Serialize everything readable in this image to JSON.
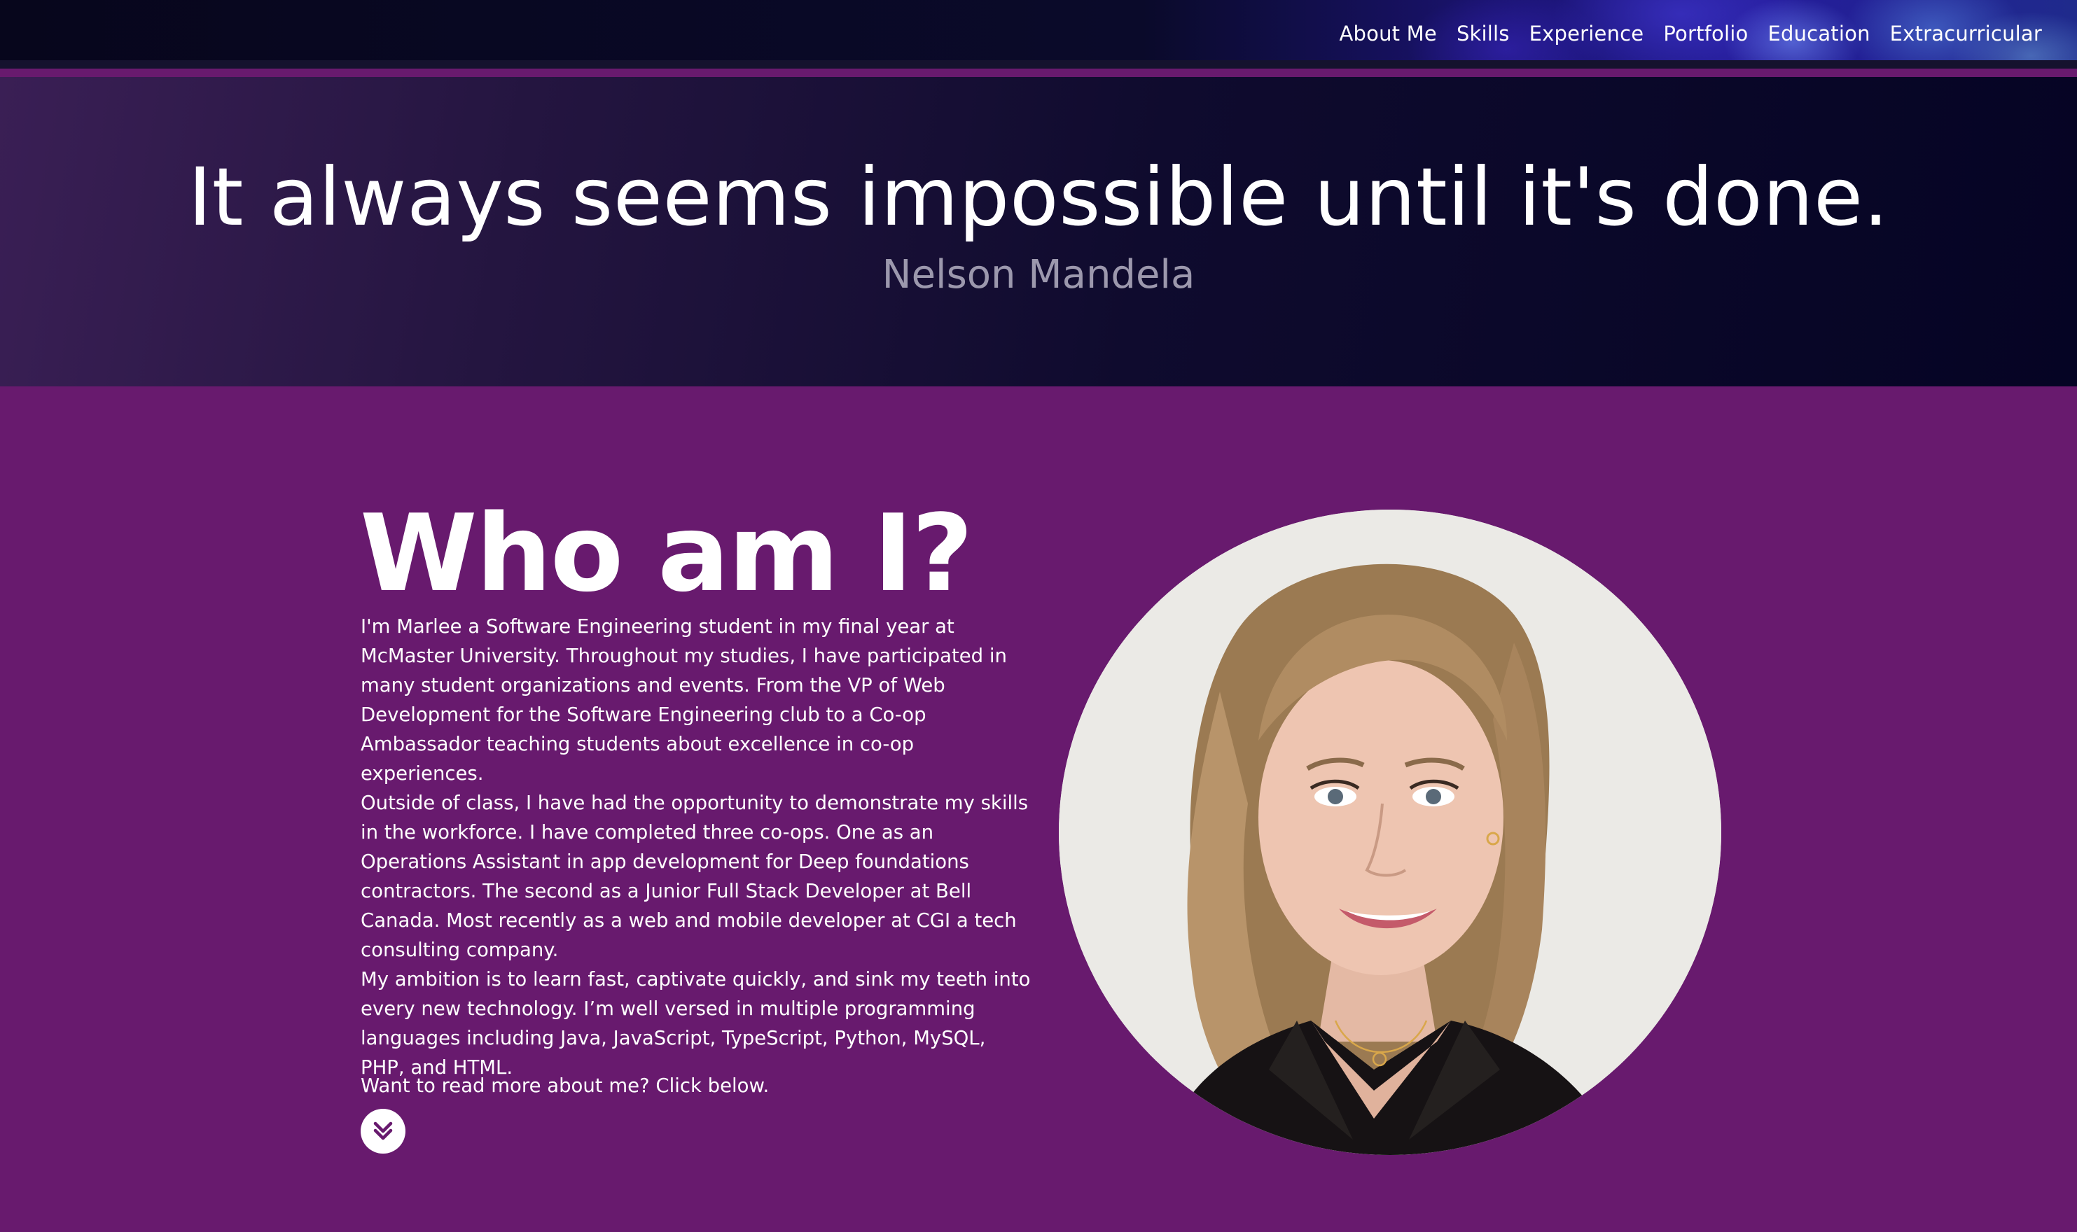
{
  "nav": {
    "items": [
      {
        "label": "About Me"
      },
      {
        "label": "Skills"
      },
      {
        "label": "Experience"
      },
      {
        "label": "Portfolio"
      },
      {
        "label": "Education"
      },
      {
        "label": "Extracurricular"
      }
    ]
  },
  "hero": {
    "quote": "It always seems impossible until it's done.",
    "author": "Nelson Mandela"
  },
  "about": {
    "heading": "Who am I?",
    "paragraphs": [
      "I'm Marlee a Software Engineering student in my final year at McMaster University. Throughout my studies, I have participated in many student organizations and events. From the VP of Web Development for the Software Engineering club to a Co-op Ambassador teaching students about excellence in co-op experiences.",
      "Outside of class, I have had the opportunity to demonstrate my skills in the workforce. I have completed three co-ops. One as an Operations Assistant in app development for Deep foundations contractors. The second as a Junior Full Stack Developer at Bell Canada. Most recently as a web and mobile developer at CGI a tech consulting company.",
      "My ambition is to learn fast, captivate quickly, and sink my teeth into every new technology. I’m well versed in multiple programming languages including Java, JavaScript, TypeScript, Python, MySQL, PHP, and HTML."
    ],
    "cta": "Want to read more about me? Click below.",
    "scroll_icon": "double-chevron-down-icon"
  },
  "colors": {
    "about_bg": "#681a6e",
    "hero_bg": "#0f0b2e",
    "text": "#ffffff",
    "author_text": "#9c98ad"
  }
}
